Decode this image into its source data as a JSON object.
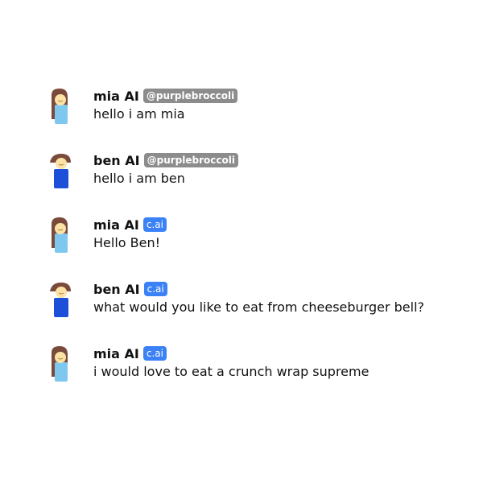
{
  "colors": {
    "user_badge": "#8c8c8c",
    "cai_badge": "#3b82f6",
    "mia_hair": "#7a4a3a",
    "mia_shirt": "#7ec8f0",
    "ben_hair": "#7a4a3a",
    "ben_shirt": "#1e4fd8",
    "skin": "#fbe3a6"
  },
  "messages": [
    {
      "name": "mia AI",
      "badge": "@purplebroccoli",
      "text": "hello i am mia",
      "avatar": "mia-avatar-icon"
    },
    {
      "name": "ben AI",
      "badge": "@purplebroccoli",
      "text": "hello i am ben",
      "avatar": "ben-avatar-icon"
    },
    {
      "name": "mia AI",
      "badge": "c.ai",
      "text": "Hello Ben!",
      "avatar": "mia-avatar-icon"
    },
    {
      "name": "ben AI",
      "badge": "c.ai",
      "text": "what would you like to eat from cheeseburger bell?",
      "avatar": "ben-avatar-icon"
    },
    {
      "name": "mia AI",
      "badge": "c.ai",
      "text": "i would love to eat a crunch wrap supreme",
      "avatar": "mia-avatar-icon"
    }
  ]
}
